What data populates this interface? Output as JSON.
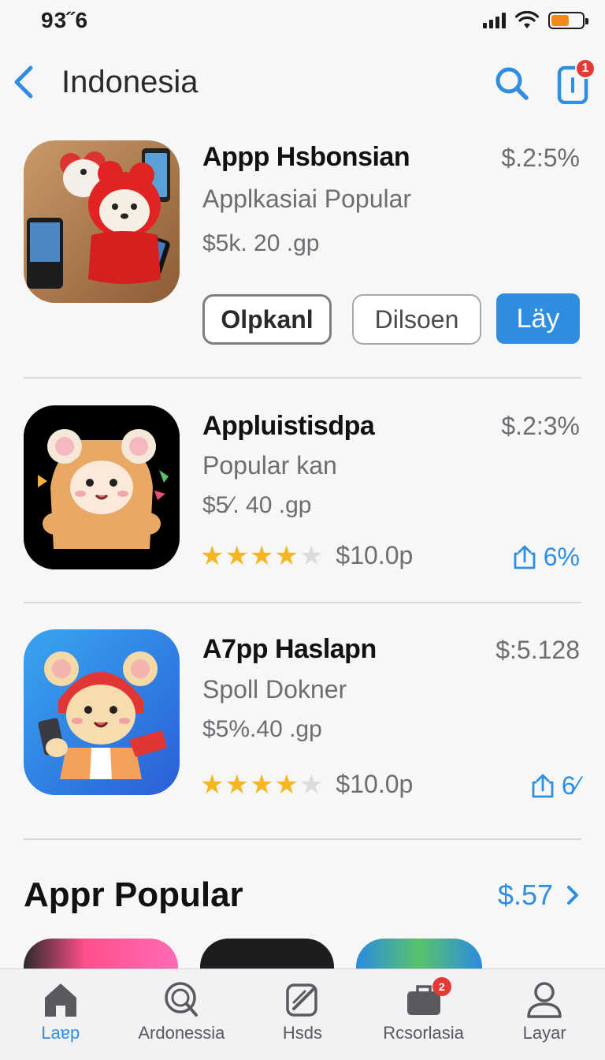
{
  "status_bar": {
    "time": "93˝6"
  },
  "nav": {
    "title": "Indonesia",
    "notification_count": "1"
  },
  "apps": [
    {
      "name": "Appp Hsbonsian",
      "subtitle": "Applkasiai Popular",
      "meta": "$5k. 20 .gp",
      "price": "$.2:5%",
      "buttons": [
        "Olpkanl",
        "Dilsoen",
        "Läy"
      ]
    },
    {
      "name": "Appluistisdpa",
      "subtitle": "Popular kan",
      "meta": "$5⁄. 40 .gp",
      "price": "$.2:3%",
      "rating": 4,
      "rating_price": "$10.0p",
      "install_stat": "6%"
    },
    {
      "name": "A7pp Haslapn",
      "subtitle": "Spoll Dokner",
      "meta": "$5%.40 .gp",
      "price": "$:5.128",
      "rating": 4,
      "rating_price": "$10.0p",
      "install_stat": "6⁄"
    }
  ],
  "section": {
    "title": "Appr Popular",
    "link_value": "$.57"
  },
  "tabs": [
    {
      "label": "Laɐp",
      "icon": "house-icon",
      "active": true
    },
    {
      "label": "Ardonessia",
      "icon": "search-icon",
      "active": false
    },
    {
      "label": "Hsds",
      "icon": "edit-icon",
      "active": false
    },
    {
      "label": "Rcsorlasia",
      "icon": "briefcase-icon",
      "active": false,
      "badge": "2"
    },
    {
      "label": "Layar",
      "icon": "person-icon",
      "active": false
    }
  ],
  "colors": {
    "accent": "#2f8ee0",
    "badge": "#e53935",
    "star": "#f5b622",
    "battery": "#f08a1c"
  }
}
